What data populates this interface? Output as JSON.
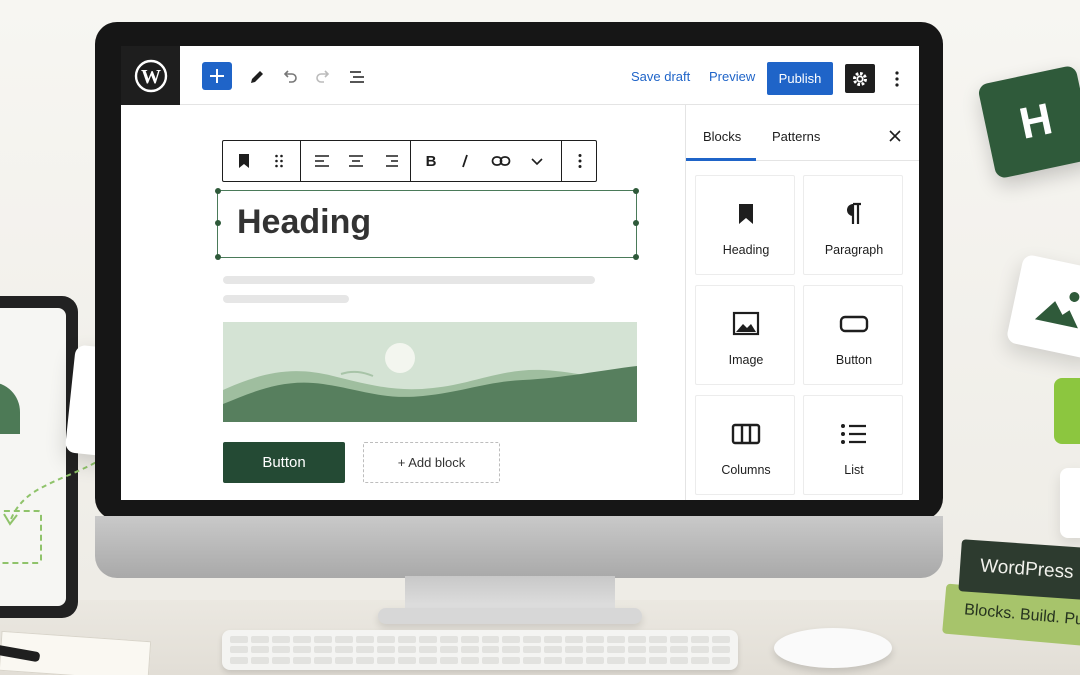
{
  "topbar": {
    "save_draft_label": "Save draft",
    "preview_label": "Preview",
    "publish_label": "Publish"
  },
  "editor": {
    "heading_text": "Heading",
    "button_label": "Button",
    "add_block_label": "+ Add block"
  },
  "sidebar": {
    "tabs": [
      {
        "label": "Blocks",
        "active": true
      },
      {
        "label": "Patterns",
        "active": false
      }
    ],
    "blocks": [
      {
        "label": "Heading",
        "icon": "bookmark-icon"
      },
      {
        "label": "Paragraph",
        "icon": "pilcrow-icon"
      },
      {
        "label": "Image",
        "icon": "image-icon"
      },
      {
        "label": "Button",
        "icon": "button-icon"
      },
      {
        "label": "Columns",
        "icon": "columns-icon"
      },
      {
        "label": "List",
        "icon": "list-icon"
      }
    ]
  },
  "floating": {
    "image_card_label": "Image",
    "heading_card_letter": "H"
  },
  "books": {
    "top_title": "WordPress",
    "bottom_title": "Blocks. Build. Pub"
  },
  "colors": {
    "accent_blue": "#1f64c8",
    "brand_green": "#244a34",
    "selection_green": "#4a7a59",
    "toolbar_dark": "#1e1e1e"
  }
}
